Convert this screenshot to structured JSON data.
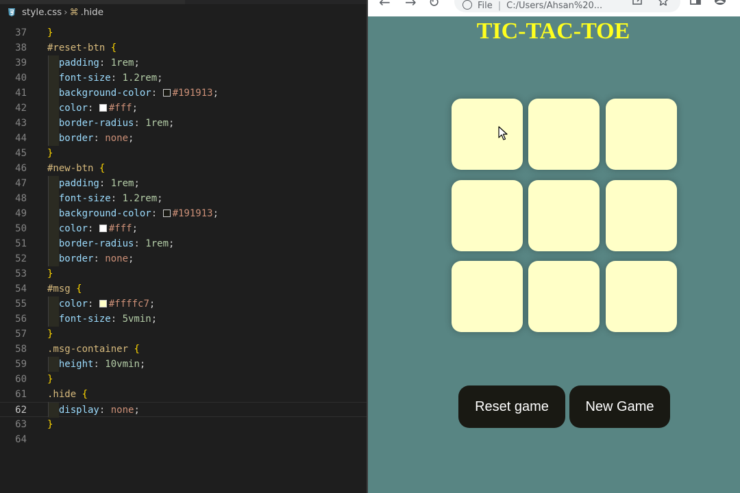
{
  "editor": {
    "breadcrumb": {
      "file": "style.css",
      "symbol": ".hide"
    },
    "active_line": 62,
    "lines": [
      {
        "n": 37,
        "indent": 0,
        "tokens": [
          {
            "c": "brace",
            "t": "}"
          }
        ]
      },
      {
        "n": 38,
        "indent": 0,
        "tokens": [
          {
            "c": "sel",
            "t": "#reset-btn "
          },
          {
            "c": "brace",
            "t": "{"
          }
        ]
      },
      {
        "n": 39,
        "indent": 1,
        "tokens": [
          {
            "c": "prop",
            "t": "padding"
          },
          {
            "c": "punc",
            "t": ": "
          },
          {
            "c": "num-v",
            "t": "1rem"
          },
          {
            "c": "punc",
            "t": ";"
          }
        ]
      },
      {
        "n": 40,
        "indent": 1,
        "tokens": [
          {
            "c": "prop",
            "t": "font-size"
          },
          {
            "c": "punc",
            "t": ": "
          },
          {
            "c": "num-v",
            "t": "1.2rem"
          },
          {
            "c": "punc",
            "t": ";"
          }
        ]
      },
      {
        "n": 41,
        "indent": 1,
        "tokens": [
          {
            "c": "prop",
            "t": "background-color"
          },
          {
            "c": "punc",
            "t": ": "
          },
          {
            "c": "swatch",
            "t": "#191913"
          },
          {
            "c": "str",
            "t": "#191913"
          },
          {
            "c": "punc",
            "t": ";"
          }
        ]
      },
      {
        "n": 42,
        "indent": 1,
        "tokens": [
          {
            "c": "prop",
            "t": "color"
          },
          {
            "c": "punc",
            "t": ": "
          },
          {
            "c": "swatch",
            "t": "#ffffff"
          },
          {
            "c": "str",
            "t": "#fff"
          },
          {
            "c": "punc",
            "t": ";"
          }
        ]
      },
      {
        "n": 43,
        "indent": 1,
        "tokens": [
          {
            "c": "prop",
            "t": "border-radius"
          },
          {
            "c": "punc",
            "t": ": "
          },
          {
            "c": "num-v",
            "t": "1rem"
          },
          {
            "c": "punc",
            "t": ";"
          }
        ]
      },
      {
        "n": 44,
        "indent": 1,
        "tokens": [
          {
            "c": "prop",
            "t": "border"
          },
          {
            "c": "punc",
            "t": ": "
          },
          {
            "c": "str",
            "t": "none"
          },
          {
            "c": "punc",
            "t": ";"
          }
        ]
      },
      {
        "n": 45,
        "indent": 0,
        "tokens": [
          {
            "c": "brace",
            "t": "}"
          }
        ]
      },
      {
        "n": 46,
        "indent": 0,
        "tokens": [
          {
            "c": "sel",
            "t": "#new-btn "
          },
          {
            "c": "brace",
            "t": "{"
          }
        ]
      },
      {
        "n": 47,
        "indent": 1,
        "tokens": [
          {
            "c": "prop",
            "t": "padding"
          },
          {
            "c": "punc",
            "t": ": "
          },
          {
            "c": "num-v",
            "t": "1rem"
          },
          {
            "c": "punc",
            "t": ";"
          }
        ]
      },
      {
        "n": 48,
        "indent": 1,
        "tokens": [
          {
            "c": "prop",
            "t": "font-size"
          },
          {
            "c": "punc",
            "t": ": "
          },
          {
            "c": "num-v",
            "t": "1.2rem"
          },
          {
            "c": "punc",
            "t": ";"
          }
        ]
      },
      {
        "n": 49,
        "indent": 1,
        "tokens": [
          {
            "c": "prop",
            "t": "background-color"
          },
          {
            "c": "punc",
            "t": ": "
          },
          {
            "c": "swatch",
            "t": "#191913"
          },
          {
            "c": "str",
            "t": "#191913"
          },
          {
            "c": "punc",
            "t": ";"
          }
        ]
      },
      {
        "n": 50,
        "indent": 1,
        "tokens": [
          {
            "c": "prop",
            "t": "color"
          },
          {
            "c": "punc",
            "t": ": "
          },
          {
            "c": "swatch",
            "t": "#ffffff"
          },
          {
            "c": "str",
            "t": "#fff"
          },
          {
            "c": "punc",
            "t": ";"
          }
        ]
      },
      {
        "n": 51,
        "indent": 1,
        "tokens": [
          {
            "c": "prop",
            "t": "border-radius"
          },
          {
            "c": "punc",
            "t": ": "
          },
          {
            "c": "num-v",
            "t": "1rem"
          },
          {
            "c": "punc",
            "t": ";"
          }
        ]
      },
      {
        "n": 52,
        "indent": 1,
        "tokens": [
          {
            "c": "prop",
            "t": "border"
          },
          {
            "c": "punc",
            "t": ": "
          },
          {
            "c": "str",
            "t": "none"
          },
          {
            "c": "punc",
            "t": ";"
          }
        ]
      },
      {
        "n": 53,
        "indent": 0,
        "tokens": [
          {
            "c": "brace",
            "t": "}"
          }
        ]
      },
      {
        "n": 54,
        "indent": 0,
        "tokens": [
          {
            "c": "sel",
            "t": "#msg "
          },
          {
            "c": "brace",
            "t": "{"
          }
        ]
      },
      {
        "n": 55,
        "indent": 1,
        "tokens": [
          {
            "c": "prop",
            "t": "color"
          },
          {
            "c": "punc",
            "t": ": "
          },
          {
            "c": "swatch",
            "t": "#ffffc7"
          },
          {
            "c": "str",
            "t": "#ffffc7"
          },
          {
            "c": "punc",
            "t": ";"
          }
        ]
      },
      {
        "n": 56,
        "indent": 1,
        "tokens": [
          {
            "c": "prop",
            "t": "font-size"
          },
          {
            "c": "punc",
            "t": ": "
          },
          {
            "c": "num-v",
            "t": "5vmin"
          },
          {
            "c": "punc",
            "t": ";"
          }
        ]
      },
      {
        "n": 57,
        "indent": 0,
        "tokens": [
          {
            "c": "brace",
            "t": "}"
          }
        ]
      },
      {
        "n": 58,
        "indent": 0,
        "tokens": [
          {
            "c": "sel",
            "t": ".msg-container "
          },
          {
            "c": "brace",
            "t": "{"
          }
        ]
      },
      {
        "n": 59,
        "indent": 1,
        "tokens": [
          {
            "c": "prop",
            "t": "height"
          },
          {
            "c": "punc",
            "t": ": "
          },
          {
            "c": "num-v",
            "t": "10vmin"
          },
          {
            "c": "punc",
            "t": ";"
          }
        ]
      },
      {
        "n": 60,
        "indent": 0,
        "tokens": [
          {
            "c": "brace",
            "t": "}"
          }
        ]
      },
      {
        "n": 61,
        "indent": 0,
        "tokens": [
          {
            "c": "sel",
            "t": ".hide "
          },
          {
            "c": "brace",
            "t": "{"
          }
        ]
      },
      {
        "n": 62,
        "indent": 1,
        "tokens": [
          {
            "c": "prop",
            "t": "display"
          },
          {
            "c": "punc",
            "t": ": "
          },
          {
            "c": "str",
            "t": "none"
          },
          {
            "c": "punc",
            "t": ";"
          }
        ]
      },
      {
        "n": 63,
        "indent": 0,
        "tokens": [
          {
            "c": "brace",
            "t": "}"
          }
        ]
      },
      {
        "n": 64,
        "indent": 0,
        "tokens": []
      }
    ]
  },
  "browser": {
    "address": {
      "scheme": "File",
      "path": "C:/Users/Ahsan%20..."
    },
    "page": {
      "title": "TIC-TAC-TOE",
      "board": [
        "",
        "",
        "",
        "",
        "",
        "",
        "",
        "",
        ""
      ],
      "buttons": {
        "reset": "Reset game",
        "new": "New Game"
      }
    }
  },
  "colors": {
    "page_bg": "#588583",
    "box": "#ffffc7",
    "title": "#ffff1f",
    "button_bg": "#191913",
    "button_text": "#ffffff"
  }
}
